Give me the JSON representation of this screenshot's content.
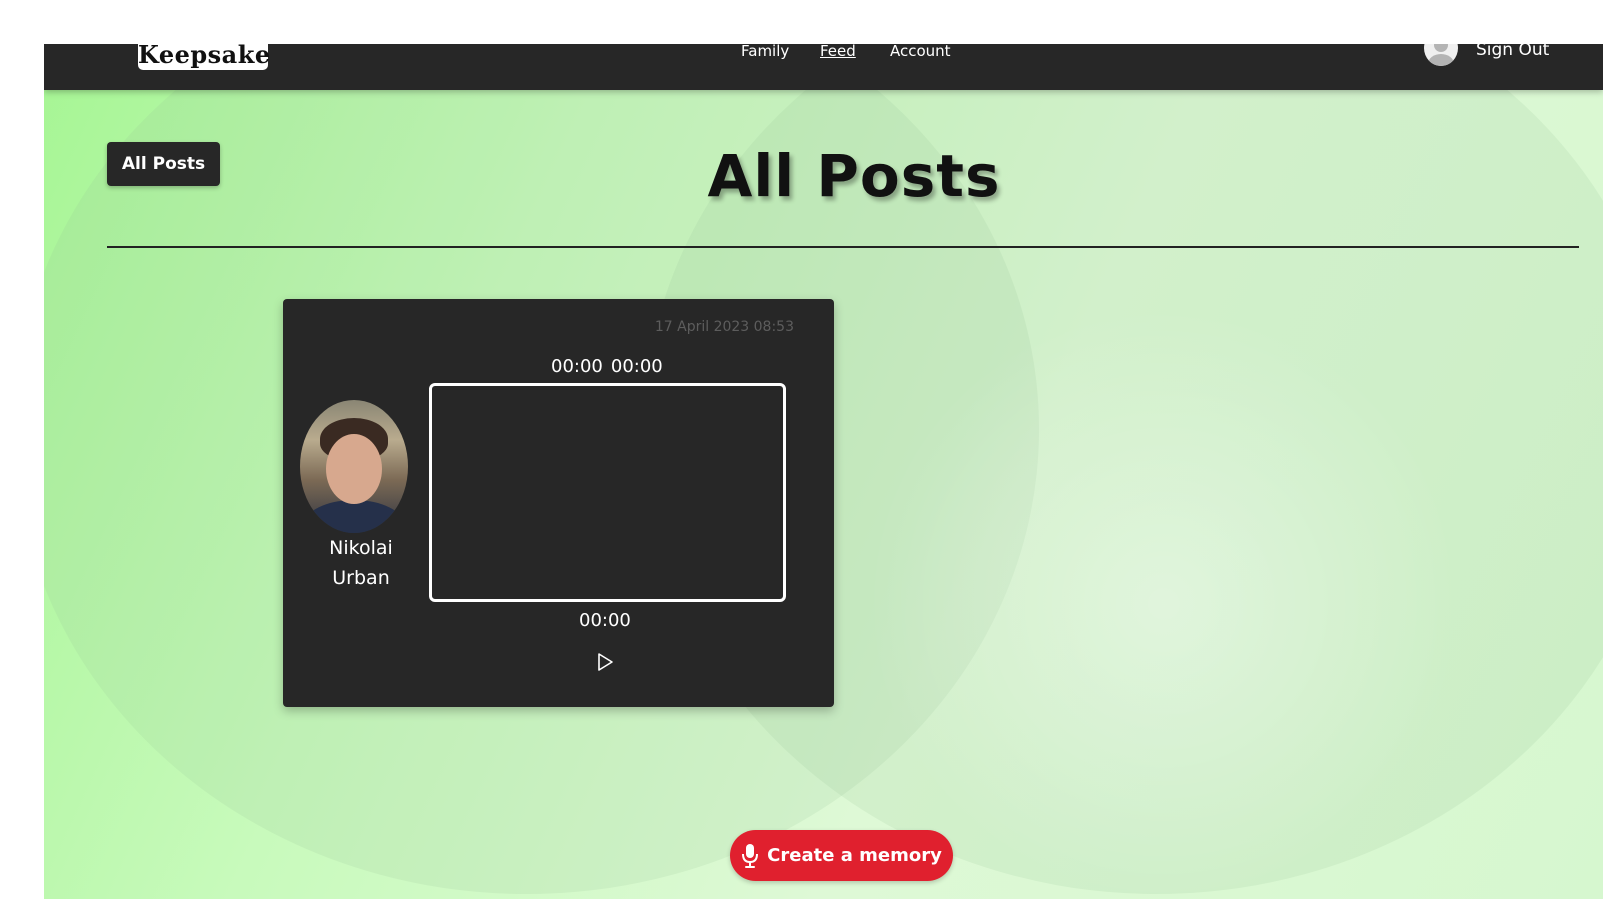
{
  "nav": {
    "logo": "Keepsake",
    "links": [
      {
        "label": "Family",
        "active": false
      },
      {
        "label": "Feed",
        "active": true
      },
      {
        "label": "Account",
        "active": false
      }
    ],
    "sign_out": "Sign Out",
    "avatar_icon": "user-avatar-icon"
  },
  "header": {
    "filter_button": "All Posts",
    "title": "All Posts"
  },
  "post": {
    "date": "17 April 2023 08:53",
    "author_name": "Nikolai Urban",
    "time_current": "00:00",
    "time_total": "00:00",
    "time_bottom": "00:00",
    "play_icon": "play-icon"
  },
  "actions": {
    "create_memory": "Create a memory",
    "create_memory_icon": "microphone-icon"
  },
  "colors": {
    "navbar": "#272727",
    "card": "#272727",
    "accent_red": "#e0202e",
    "background_green": "#c8fabc",
    "date_text": "#5d5d5d"
  }
}
